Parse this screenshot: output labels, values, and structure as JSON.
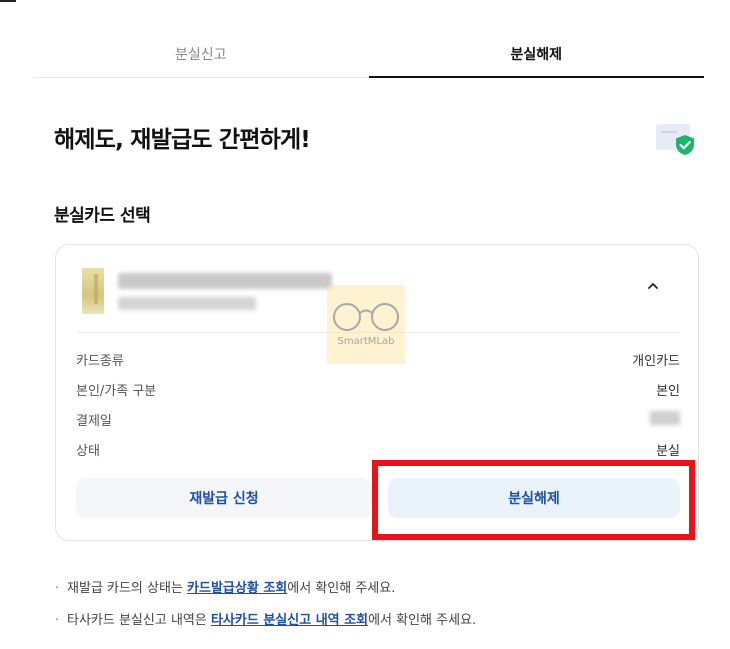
{
  "tabs": [
    {
      "label": "분실신고",
      "active": false
    },
    {
      "label": "분실해제",
      "active": true
    }
  ],
  "headline": "해제도, 재발급도 간편하게!",
  "section_title": "분실카드 선택",
  "card_details": {
    "rows": [
      {
        "label": "카드종류",
        "value": "개인카드"
      },
      {
        "label": "본인/가족 구분",
        "value": "본인"
      },
      {
        "label": "결제일",
        "value": ""
      },
      {
        "label": "상태",
        "value": "분실"
      }
    ]
  },
  "buttons": {
    "reissue": "재발급 신청",
    "unlock": "분실해제"
  },
  "watermark": "SmartMLab",
  "notes": [
    {
      "before": "재발급 카드의 상태는 ",
      "link": "카드발급상황 조회",
      "after": "에서 확인해 주세요."
    },
    {
      "before": "타사카드 분실신고 내역은 ",
      "link": "타사카드 분실신고 내역 조회",
      "after": "에서 확인해 주세요."
    }
  ],
  "colors": {
    "accent": "#1d4fa8",
    "highlight": "#e8141a",
    "shield": "#1bb56c"
  }
}
